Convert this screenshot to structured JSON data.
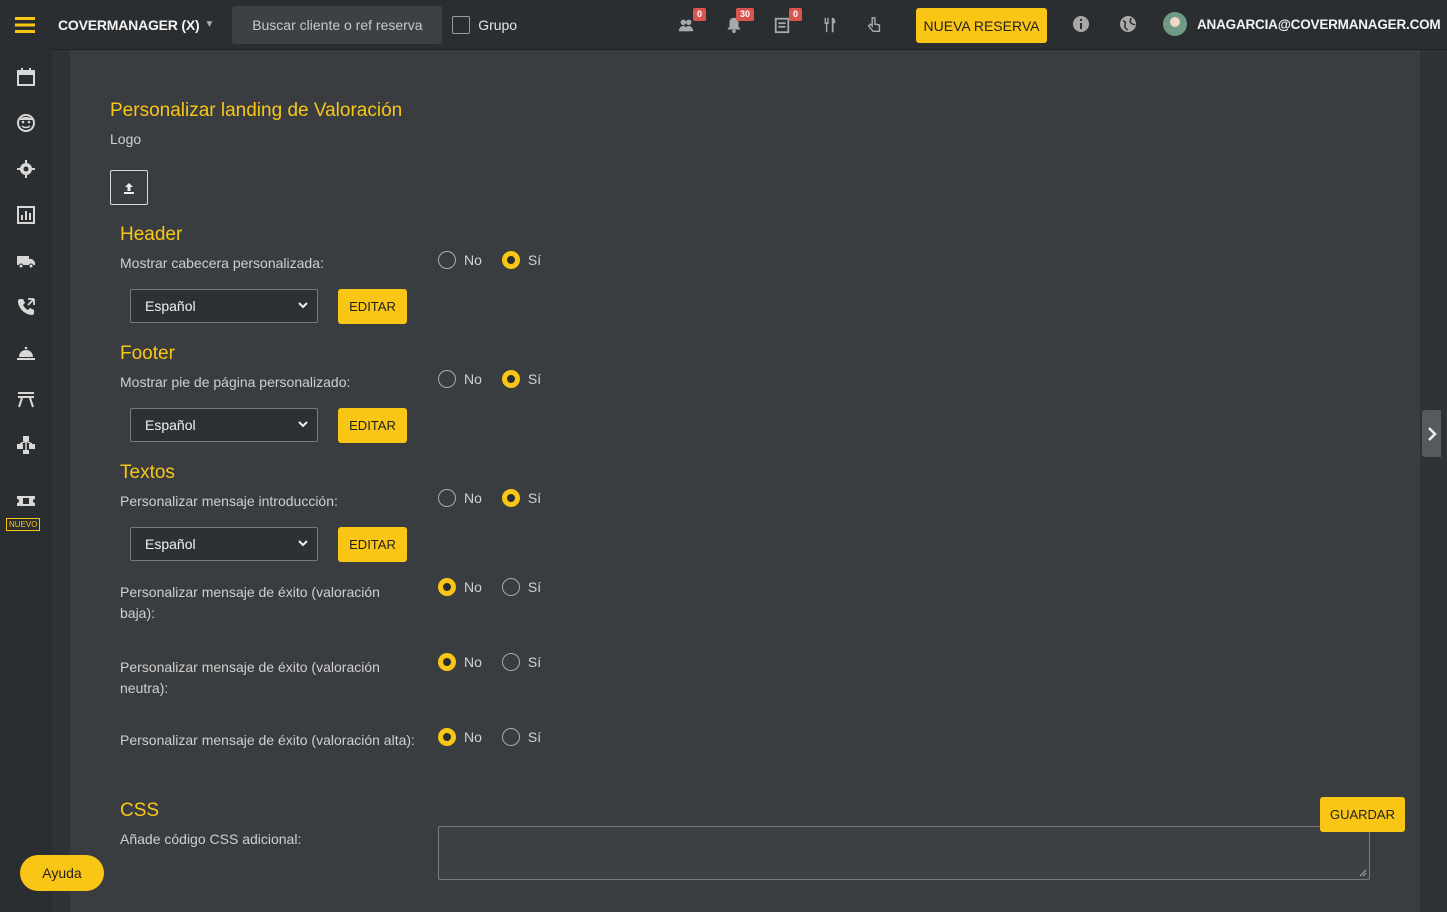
{
  "topbar": {
    "brand": "COVERMANAGER (X)",
    "search_placeholder": "Buscar cliente o ref reserva",
    "grupo_label": "Grupo",
    "badges": {
      "group_requests": "0",
      "notifications": "30",
      "pending": "0"
    },
    "new_booking_label": "NUEVA RESERVA",
    "user_email": "ANAGARCIA@COVERMANAGER.COM"
  },
  "sidebar": {
    "items": [
      "calendar-icon",
      "face-icon",
      "gear-icon",
      "chart-icon",
      "truck-icon",
      "phone-icon",
      "cloche-icon",
      "table-icon",
      "network-icon",
      "ticket-icon"
    ],
    "nuevo_label": "NUEVO"
  },
  "page": {
    "title": "Personalizar landing de Valoración",
    "logo_label": "Logo",
    "header": {
      "title": "Header",
      "option_label": "Mostrar cabecera personalizada:",
      "selected": "Sí",
      "language": "Español",
      "edit_label": "EDITAR"
    },
    "footer": {
      "title": "Footer",
      "option_label": "Mostrar pie de página personalizado:",
      "selected": "Sí",
      "language": "Español",
      "edit_label": "EDITAR"
    },
    "textos": {
      "title": "Textos",
      "intro_label": "Personalizar mensaje introducción:",
      "intro_selected": "Sí",
      "language": "Español",
      "edit_label": "EDITAR",
      "low_label": "Personalizar mensaje de éxito (valoración baja):",
      "low_selected": "No",
      "neutral_label": "Personalizar mensaje de éxito (valoración neutra):",
      "neutral_selected": "No",
      "high_label": "Personalizar mensaje de éxito (valoración alta):",
      "high_selected": "No"
    },
    "css": {
      "title": "CSS",
      "label": "Añade código CSS adicional:",
      "save_label": "GUARDAR",
      "value": ""
    },
    "radio_no": "No",
    "radio_si": "Sí"
  },
  "help_label": "Ayuda"
}
